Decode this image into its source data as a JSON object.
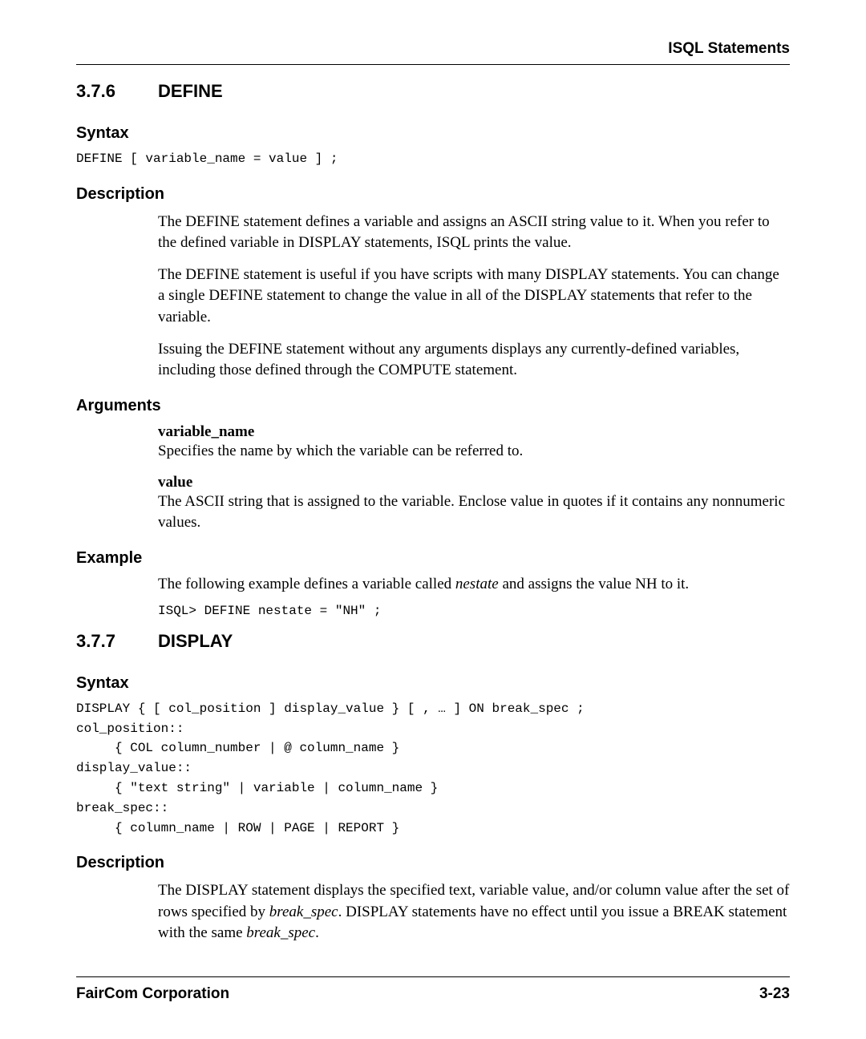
{
  "header": {
    "running": "ISQL Statements"
  },
  "sec1": {
    "num": "3.7.6",
    "title": "DEFINE",
    "syntax_h": "Syntax",
    "syntax_code": "DEFINE [ variable_name = value ] ;",
    "desc_h": "Description",
    "desc_p1": "The DEFINE statement defines a variable and assigns an ASCII string value to it. When you refer to the defined variable in DISPLAY statements, ISQL prints the value.",
    "desc_p2": "The DEFINE statement is useful if you have scripts with many DISPLAY statements. You can change a single DEFINE statement to change the value in all of the DISPLAY statements that refer to the variable.",
    "desc_p3": "Issuing the DEFINE statement without any arguments displays any currently-defined variables, including those defined through the COMPUTE statement.",
    "args_h": "Arguments",
    "arg1_name": "variable_name",
    "arg1_body": "Specifies the name by which the variable can be referred to.",
    "arg2_name": "value",
    "arg2_body": "The ASCII string that is assigned to the variable. Enclose value in quotes if it contains any nonnumeric values.",
    "example_h": "Example",
    "example_intro_pre": "The following example defines a variable called ",
    "example_intro_var": "nestate",
    "example_intro_post": " and assigns the value NH to it.",
    "example_code": "ISQL> DEFINE nestate = \"NH\" ;"
  },
  "sec2": {
    "num": "3.7.7",
    "title": "DISPLAY",
    "syntax_h": "Syntax",
    "syntax_code": "DISPLAY { [ col_position ] display_value } [ , … ] ON break_spec ;\ncol_position::\n     { COL column_number | @ column_name }\ndisplay_value::\n     { \"text string\" | variable | column_name }\nbreak_spec::\n     { column_name | ROW | PAGE | REPORT }",
    "desc_h": "Description",
    "desc2_a": "The DISPLAY statement displays the specified text, variable value, and/or column value after the set of rows specified by ",
    "desc2_b": "break_spec",
    "desc2_c": ". DISPLAY statements have no effect until you issue a BREAK statement with the same ",
    "desc2_d": "break_spec",
    "desc2_e": "."
  },
  "footer": {
    "company": "FairCom Corporation",
    "page": "3-23"
  }
}
